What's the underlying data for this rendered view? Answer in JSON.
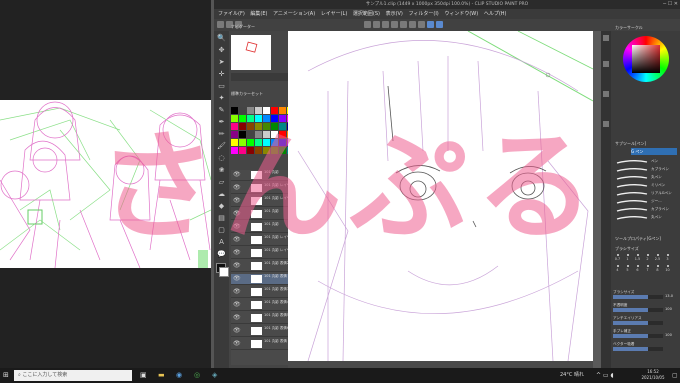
{
  "window": {
    "title": "サンプル1.clip (1449 x 1000px 350dpi 100.0%) - CLIP STUDIO PAINT PRO"
  },
  "menu": [
    "ファイル(F)",
    "編集(E)",
    "アニメーション(A)",
    "レイヤー(L)",
    "選択範囲(S)",
    "表示(V)",
    "フィルター(I)",
    "ウィンドウ(W)",
    "ヘルプ(H)"
  ],
  "navigator": {
    "title": "ナビゲーター"
  },
  "palette": {
    "title": "標準カラーセット"
  },
  "layers": {
    "items": [
      {
        "label": "101 丸影"
      },
      {
        "label": "101 丸影 レイヤー 1"
      },
      {
        "label": "101 丸影 レイヤー 3"
      },
      {
        "label": "101 丸影"
      },
      {
        "label": "101 丸影"
      },
      {
        "label": "101 丸影 レイヤー 3"
      },
      {
        "label": "101 丸影 レイヤー 4"
      },
      {
        "label": "101 丸影 表情2"
      },
      {
        "label": "101 丸影 表情"
      },
      {
        "label": "101 丸影 表情3"
      },
      {
        "label": "101 丸影 表情4"
      },
      {
        "label": "101 丸影 表情5"
      },
      {
        "label": "101 丸影 表情6"
      },
      {
        "label": "101 丸影 表情"
      }
    ]
  },
  "right_panel": {
    "color_title": "カラーサークル",
    "subtool_group": "サブツール[ペン]",
    "brush_name": "G ペン",
    "brushes": [
      "ペン",
      "カブラペン",
      "丸ペン",
      "ミリペン",
      "リアルGペン",
      "ジー...",
      "カブラペン",
      "丸ペン"
    ],
    "tool_property_title": "ツールプロパティ[Gペン]",
    "brush_size_title": "ブラシサイズ",
    "brush_sizes": [
      "0.7",
      "1",
      "1.5",
      "2",
      "2.5",
      "3",
      "4",
      "5",
      "6",
      "7",
      "8",
      "10"
    ],
    "prop_labels": [
      "ブラシサイズ",
      "不透明度",
      "アンチエイリアス",
      "手ブレ補正",
      "ベクター吸着"
    ],
    "prop_values": [
      "13.0",
      "100",
      "",
      "100"
    ]
  },
  "watermark": {
    "text": "さんぷる"
  },
  "taskbar": {
    "search_placeholder": "ここに入力して検索",
    "weather": "24°C 晴れ",
    "time": "16:52",
    "date": "2021/10/05"
  },
  "colors": {
    "watermark": "#ef5f8f",
    "sketch_line": "#e070c8",
    "perspective_line": "#7ddc7a",
    "csp_bg": "#3a3a3a"
  }
}
